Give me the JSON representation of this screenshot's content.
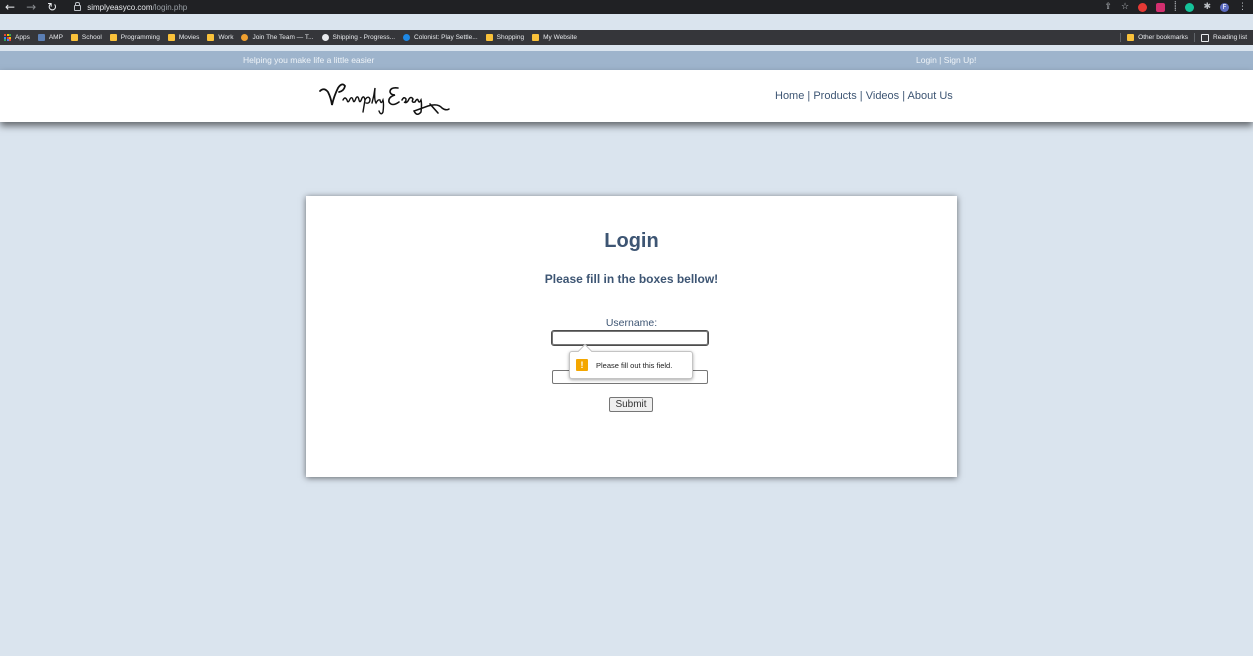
{
  "browser": {
    "url_host": "simplyeasyco.com",
    "url_path": "/login.php",
    "bookmarks": [
      {
        "label": "Apps",
        "icon": "apps-grid-icon"
      },
      {
        "label": "AMP",
        "icon": "amp-icon"
      },
      {
        "label": "School",
        "icon": "folder-icon"
      },
      {
        "label": "Programming",
        "icon": "folder-icon"
      },
      {
        "label": "Movies",
        "icon": "folder-icon"
      },
      {
        "label": "Work",
        "icon": "folder-icon"
      },
      {
        "label": "Join The Team — T...",
        "icon": "site-icon"
      },
      {
        "label": "Shipping - Progress...",
        "icon": "site-icon"
      },
      {
        "label": "Colonist: Play Settle...",
        "icon": "site-icon"
      },
      {
        "label": "Shopping",
        "icon": "folder-icon"
      },
      {
        "label": "My Website",
        "icon": "folder-icon"
      }
    ],
    "other_bookmarks": "Other bookmarks",
    "reading_list": "Reading list",
    "profile_initial": "F"
  },
  "site": {
    "tagline": "Helping you make life a little easier",
    "login_signup": "Login | Sign Up!",
    "logo_text": "SimplyEasy",
    "nav": {
      "home": "Home",
      "products": "Products",
      "videos": "Videos",
      "about": "About Us",
      "separator": " | "
    }
  },
  "login": {
    "title": "Login",
    "subtitle": "Please fill in the boxes bellow!",
    "username_label": "Username:",
    "username_value": "",
    "password_value": "",
    "submit_label": "Submit",
    "validation_message": "Please fill out this field."
  },
  "colors": {
    "page_bg": "#dae4ee",
    "topbar_bg": "#9eb4cc",
    "text_blue": "#3d5573",
    "warning": "#f4a700"
  }
}
